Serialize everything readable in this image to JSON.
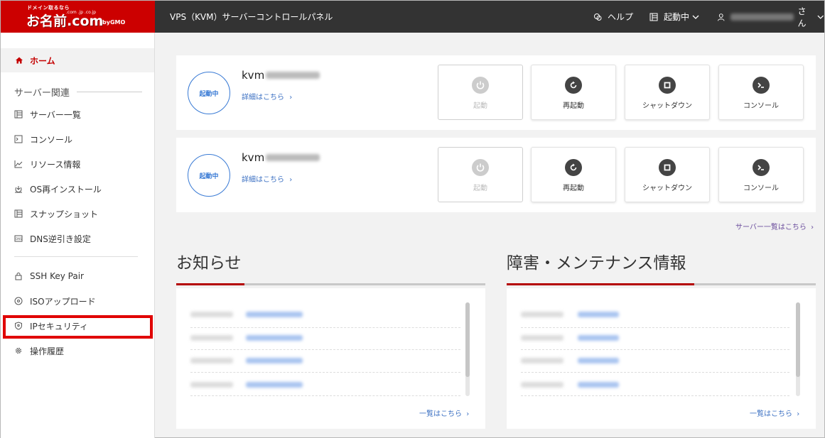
{
  "logo": {
    "tagline": "ドメイン取るなら",
    "brand": "お名前.com",
    "tlds": ".com .jp .co.jp",
    "by": "byGMO"
  },
  "header": {
    "title": "VPS（KVM）サーバーコントロールパネル",
    "help": "ヘルプ",
    "status": "起動中",
    "user_suffix": "さん"
  },
  "sidebar": {
    "home": "ホーム",
    "section": "サーバー関連",
    "items": [
      {
        "label": "サーバー一覧",
        "icon": "server-list-icon"
      },
      {
        "label": "コンソール",
        "icon": "console-icon"
      },
      {
        "label": "リソース情報",
        "icon": "chart-icon"
      },
      {
        "label": "OS再インストール",
        "icon": "reinstall-icon"
      },
      {
        "label": "スナップショット",
        "icon": "snapshot-icon"
      },
      {
        "label": "DNS逆引き設定",
        "icon": "dns-icon"
      }
    ],
    "items2": [
      {
        "label": "SSH Key Pair",
        "icon": "lock-icon"
      },
      {
        "label": "ISOアップロード",
        "icon": "disc-icon"
      },
      {
        "label": "IPセキュリティ",
        "icon": "shield-icon"
      },
      {
        "label": "操作履歴",
        "icon": "gear-icon"
      }
    ]
  },
  "servers": [
    {
      "status": "起動中",
      "name": "kvm",
      "detail": "詳細はこちら"
    },
    {
      "status": "起動中",
      "name": "kvm",
      "detail": "詳細はこちら"
    }
  ],
  "actions": {
    "start": "起動",
    "restart": "再起動",
    "shutdown": "シャットダウン",
    "console": "コンソール"
  },
  "server_list_link": "サーバー一覧はこちら",
  "news": {
    "title": "お知らせ",
    "more": "一覧はこちら"
  },
  "maintenance": {
    "title": "障害・メンテナンス情報",
    "more": "一覧はこちら"
  },
  "colors": {
    "brand_red": "#cc0000",
    "header_bg": "#333333",
    "accent_blue": "#3a7bd5"
  }
}
